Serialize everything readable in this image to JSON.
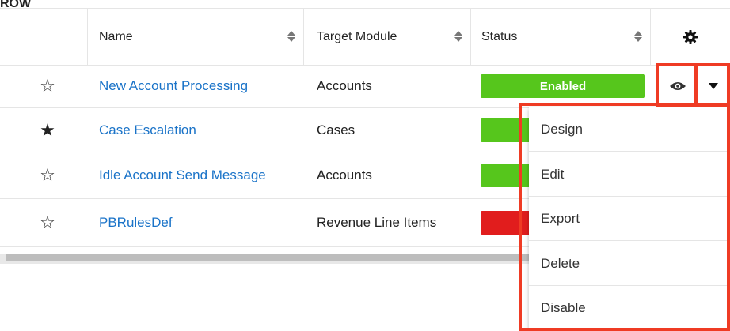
{
  "top_cut_text": "ROW",
  "columns": {
    "name": "Name",
    "target_module": "Target Module",
    "status": "Status"
  },
  "icons": {
    "settings": "gear-icon",
    "sort": "sort-icon",
    "favorite_empty": "star-outline-icon",
    "favorite_filled": "star-filled-icon",
    "preview": "eye-icon",
    "actions": "caret-down-icon"
  },
  "rows": [
    {
      "favorite": false,
      "name": "New Account Processing",
      "module": "Accounts",
      "status": "Enabled",
      "status_color": "#56c61c"
    },
    {
      "favorite": true,
      "name": "Case Escalation",
      "module": "Cases",
      "status": "",
      "status_color": "#56c61c"
    },
    {
      "favorite": false,
      "name": "Idle Account Send Message",
      "module": "Accounts",
      "status": "",
      "status_color": "#56c61c"
    },
    {
      "favorite": false,
      "name": "PBRulesDef",
      "module": "Revenue Line Items",
      "status": "",
      "status_color": "#e11d1d"
    }
  ],
  "menu": [
    "Design",
    "Edit",
    "Export",
    "Delete",
    "Disable"
  ],
  "colors": {
    "link": "#1a73c8",
    "highlight": "#ef3b24",
    "enabled": "#56c61c",
    "disabled": "#e11d1d"
  }
}
